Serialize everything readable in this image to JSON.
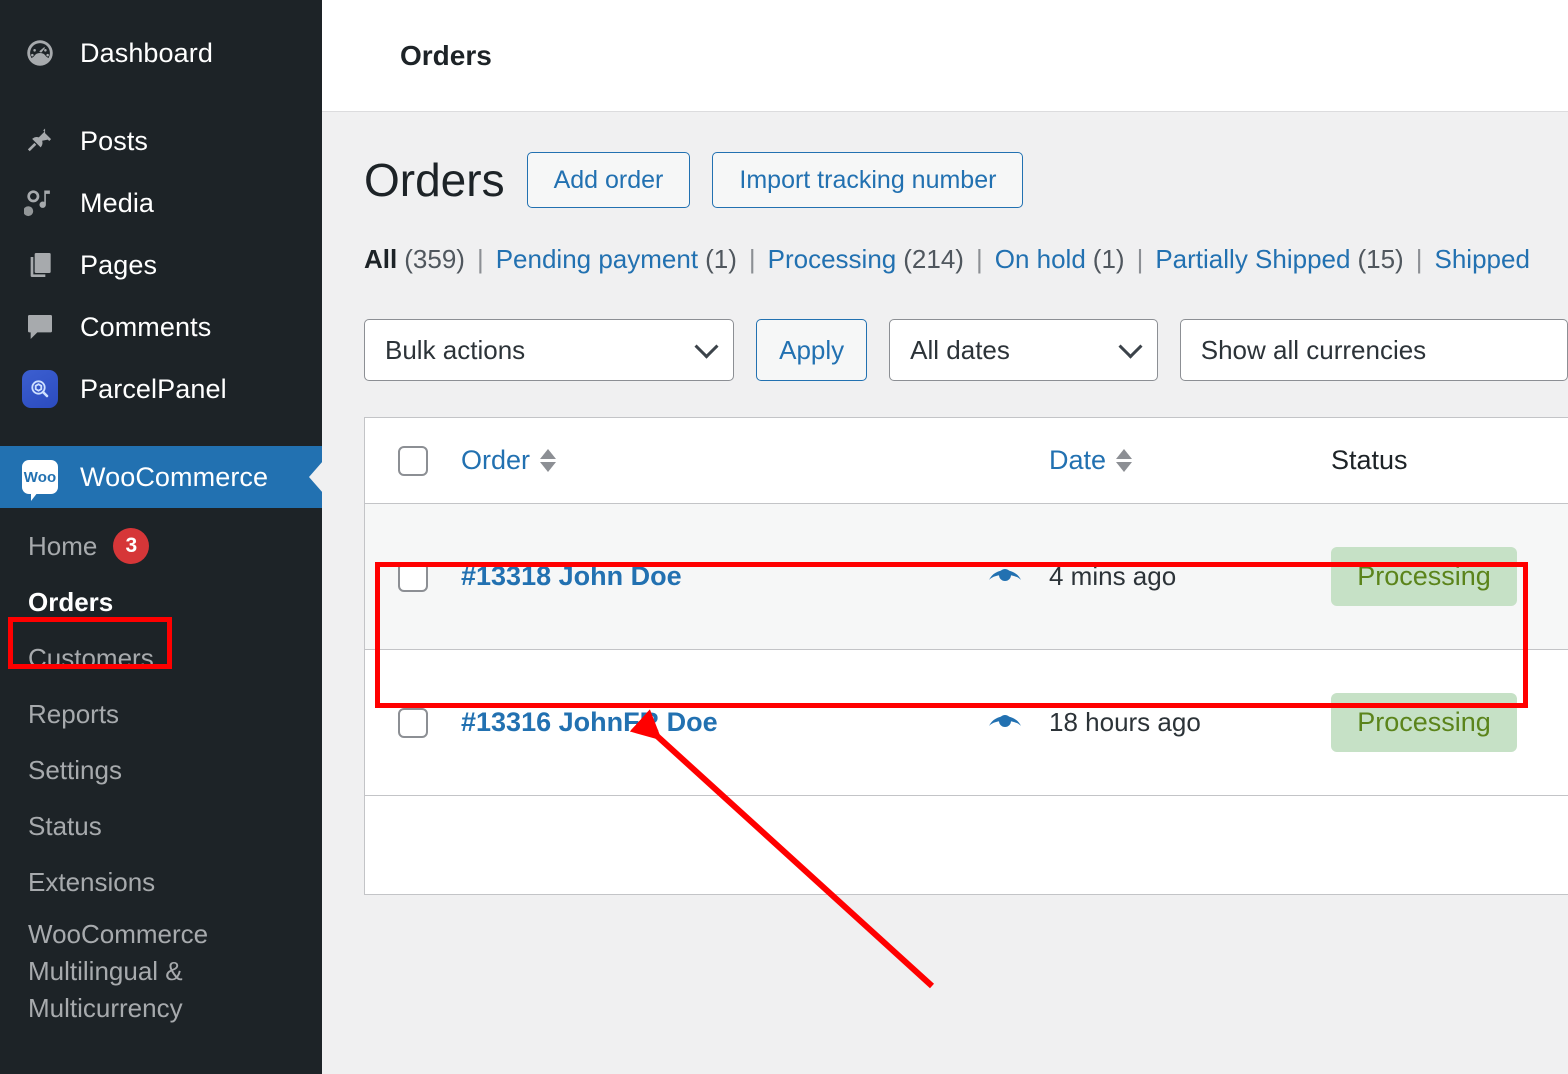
{
  "sidebar": {
    "top_items": [
      {
        "label": "Dashboard",
        "icon": "dashboard-icon"
      },
      {
        "label": "Posts",
        "icon": "pin-icon"
      },
      {
        "label": "Media",
        "icon": "media-icon"
      },
      {
        "label": "Pages",
        "icon": "pages-icon"
      },
      {
        "label": "Comments",
        "icon": "comments-icon"
      },
      {
        "label": "ParcelPanel",
        "icon": "parcelpanel-icon"
      }
    ],
    "active_item": {
      "label": "WooCommerce",
      "icon": "woocommerce-icon",
      "logo_text": "Woo"
    },
    "submenu": [
      {
        "label": "Home",
        "badge": "3"
      },
      {
        "label": "Orders",
        "badge": ""
      },
      {
        "label": "Customers",
        "badge": ""
      },
      {
        "label": "Reports",
        "badge": ""
      },
      {
        "label": "Settings",
        "badge": ""
      },
      {
        "label": "Status",
        "badge": ""
      },
      {
        "label": "Extensions",
        "badge": ""
      },
      {
        "label": "WooCommerce Multilingual & Multicurrency",
        "badge": ""
      }
    ]
  },
  "topbar": {
    "title": "Orders"
  },
  "page": {
    "title": "Orders",
    "add_order_label": "Add order",
    "import_tracking_label": "Import tracking number"
  },
  "status_filters": [
    {
      "label": "All",
      "count": "(359)",
      "current": true
    },
    {
      "label": "Pending payment",
      "count": "(1)",
      "current": false
    },
    {
      "label": "Processing",
      "count": "(214)",
      "current": false
    },
    {
      "label": "On hold",
      "count": "(1)",
      "current": false
    },
    {
      "label": "Partially Shipped",
      "count": "(15)",
      "current": false
    },
    {
      "label": "Shipped",
      "count": "",
      "current": false
    }
  ],
  "tablenav": {
    "bulk_actions_value": "Bulk actions",
    "apply_label": "Apply",
    "all_dates_value": "All dates",
    "currencies_value": "Show all currencies"
  },
  "table": {
    "headers": {
      "order": "Order",
      "date": "Date",
      "status": "Status"
    },
    "rows": [
      {
        "order": "#13318 John Doe",
        "date": "4 mins ago",
        "status": "Processing"
      },
      {
        "order": "#13316 JohnFR Doe",
        "date": "18 hours ago",
        "status": "Processing"
      }
    ]
  },
  "colors": {
    "sidebar_bg": "#1d2327",
    "active_blue": "#2271b1",
    "link_blue": "#2271b1",
    "badge_red": "#d63638",
    "status_bg": "#c6e1c6",
    "status_text": "#5b841b",
    "annotation_red": "#ff0000"
  }
}
